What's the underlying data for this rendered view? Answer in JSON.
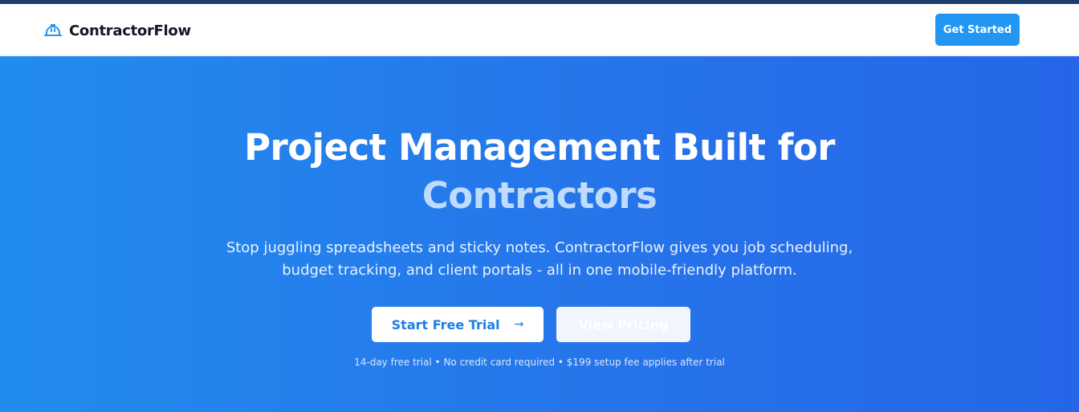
{
  "header": {
    "brand_name": "ContractorFlow",
    "brand_icon": "hard-hat-icon",
    "cta_label": "Get Started"
  },
  "hero": {
    "headline_main": "Project Management Built for",
    "headline_accent": "Contractors",
    "description": "Stop juggling spreadsheets and sticky notes. ContractorFlow gives you job scheduling, budget tracking, and client portals - all in one mobile-friendly platform.",
    "primary_cta_label": "Start Free Trial",
    "primary_cta_icon": "arrow-right-icon",
    "secondary_cta_label": "View Pricing",
    "fine_print": "14-day free trial • No credit card required • $199 setup fee applies after trial"
  },
  "colors": {
    "brand_blue": "#2196f3",
    "hero_gradient_start": "#228cee",
    "hero_gradient_end": "#2566e8",
    "accent_text": "#bfdbfe",
    "top_strip": "#1c3d6b"
  }
}
